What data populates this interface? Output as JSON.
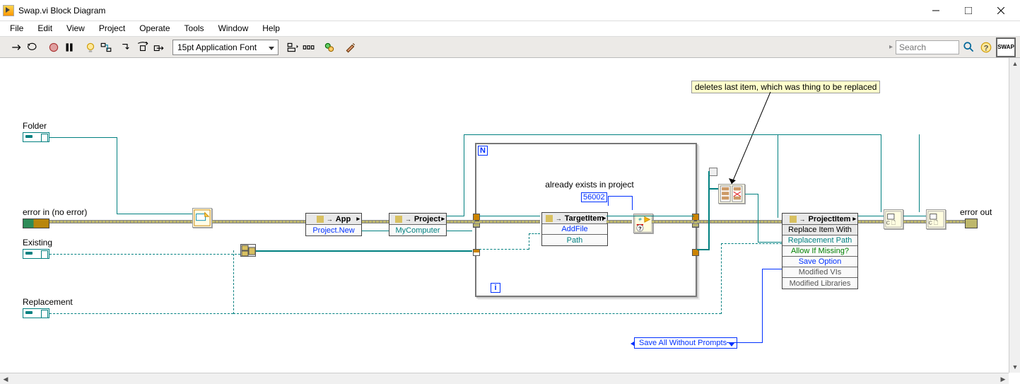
{
  "window": {
    "title": "Swap.vi Block Diagram",
    "buttons": {
      "min": "Minimize",
      "max": "Maximize",
      "close": "Close"
    }
  },
  "menu": {
    "items": [
      "File",
      "Edit",
      "View",
      "Project",
      "Operate",
      "Tools",
      "Window",
      "Help"
    ]
  },
  "toolbar": {
    "font_label": "15pt Application Font",
    "search_placeholder": "Search",
    "swap_label": "SWAP"
  },
  "diagram": {
    "labels": {
      "folder": "Folder",
      "error_in": "error in (no error)",
      "existing": "Existing",
      "replacement": "Replacement",
      "error_out": "error out",
      "loop_text": "already exists in project",
      "err_code": "56002"
    },
    "comment": "deletes last item, which was thing to be replaced",
    "ring": "Save All Without Prompts",
    "nodes": {
      "app": {
        "title": "App",
        "row": "Project.New"
      },
      "project": {
        "title": "Project",
        "row": "MyComputer"
      },
      "targetitem": {
        "title": "TargetItem",
        "rows": [
          "AddFile",
          "Path"
        ]
      },
      "projectitem": {
        "title": "ProjectItem",
        "method": "Replace Item With",
        "rows": [
          "Replacement Path",
          "Allow If Missing?",
          "Save Option",
          "Modified VIs",
          "Modified Libraries"
        ]
      }
    }
  }
}
